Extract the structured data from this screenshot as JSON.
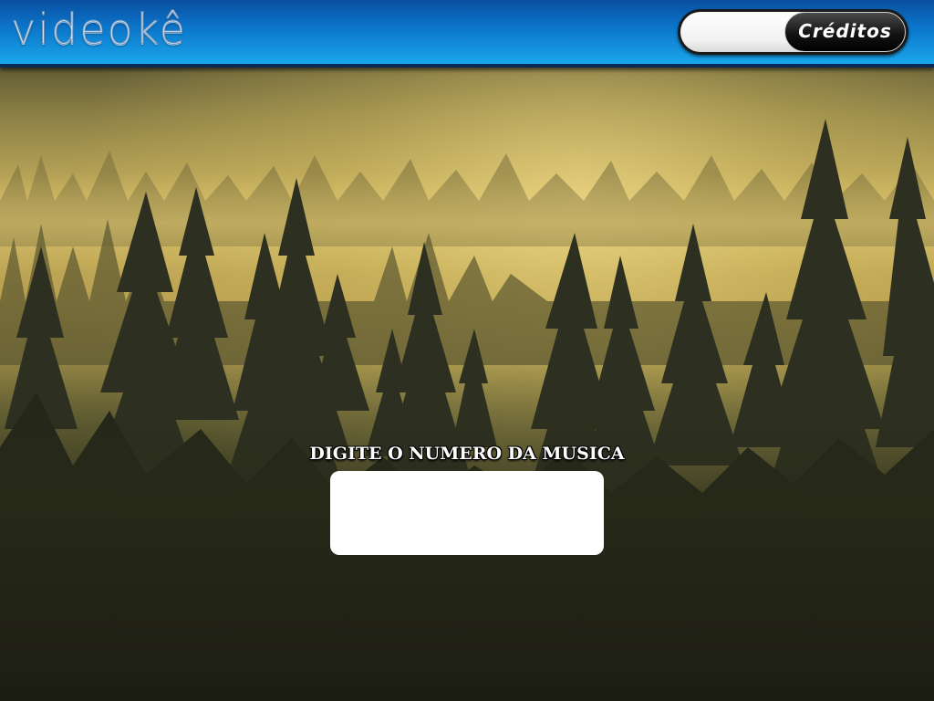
{
  "app": {
    "logo_text": "videokê",
    "credits_label": "Créditos",
    "credits_value": ""
  },
  "main": {
    "prompt_label": "DIGITE O NUMERO DA MUSICA",
    "song_number_value": ""
  },
  "colors": {
    "header_top": "#0a4fa0",
    "header_bottom": "#1aa6ea",
    "header_border": "#0a2a55",
    "credit_button_bg": "#141414",
    "input_bg": "#ffffff",
    "prompt_text": "#ffffff",
    "background_haze": "#d9c060",
    "forest_dark": "#2b2e1a"
  },
  "background": {
    "description_icon": "misty-pine-forest-image"
  }
}
